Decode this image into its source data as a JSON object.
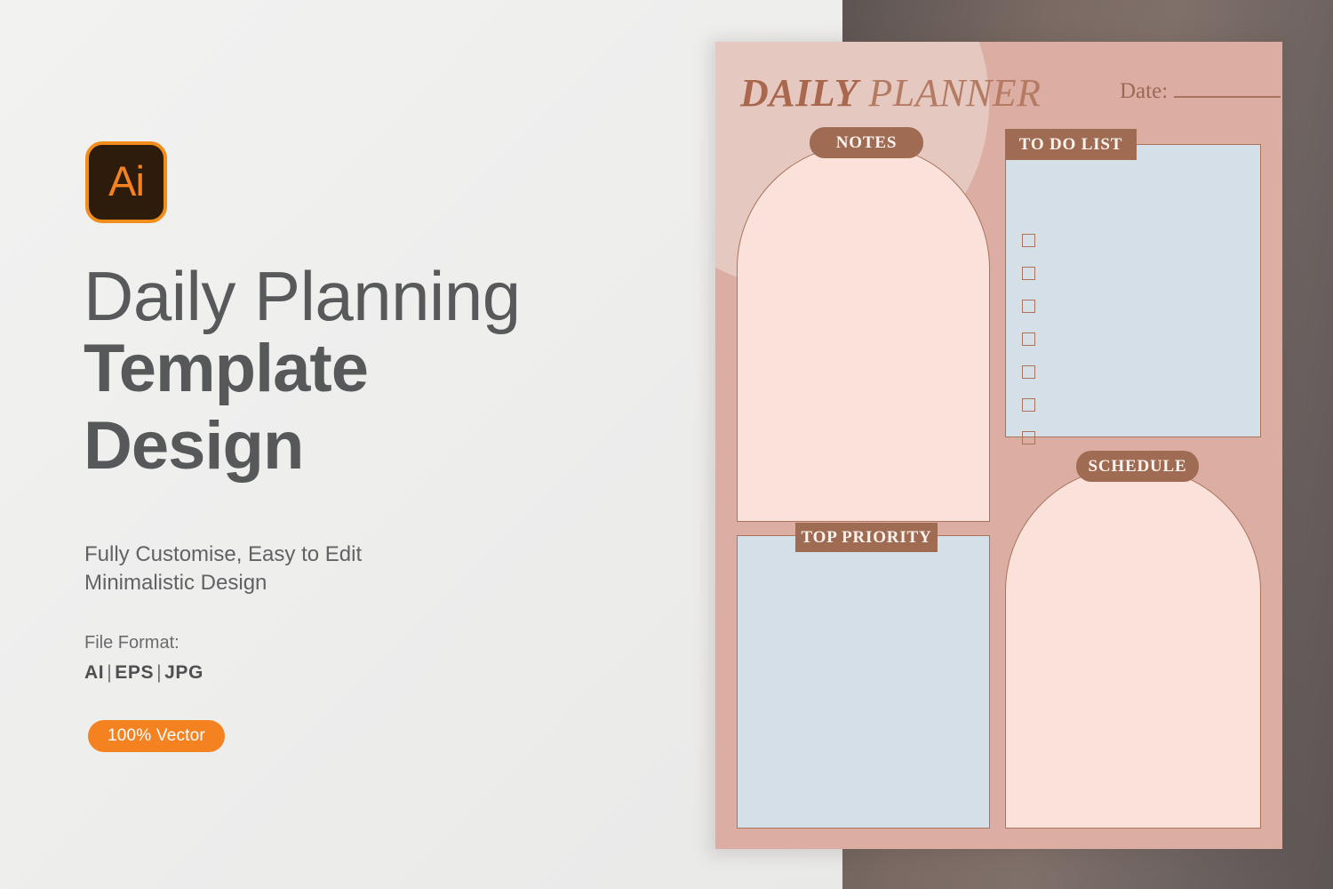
{
  "left_panel": {
    "logo": {
      "icon": "adobe-illustrator-icon",
      "text": "Ai",
      "bg_color": "#2d1c0b",
      "accent_color": "#f58220"
    },
    "headline": {
      "line1": "Daily Planning",
      "line2": "Template",
      "line3": "Design"
    },
    "subcopy": {
      "line1": "Fully Customise, Easy to Edit",
      "line2": "Minimalistic Design"
    },
    "file_format": {
      "label": "File Format:",
      "formats": [
        "AI",
        "EPS",
        "JPG"
      ],
      "separator": "|",
      "value": "AI  |  EPS  |  JPG"
    },
    "vector_badge": {
      "label": "100% Vector",
      "color": "#f58220"
    }
  },
  "planner": {
    "title_bold": "DAILY",
    "title_light": "PLANNER",
    "date_label": "Date:",
    "date_value": "",
    "colors": {
      "page_bg": "#dcaea3",
      "decor_circle": "#e5c8c0",
      "arch_fill": "#fae1da",
      "rect_fill": "#d5dfe8",
      "badge_bg": "#a06b53",
      "badge_text": "#fdf4ef",
      "outline": "#a9735c",
      "title_text": "#a9674e"
    },
    "sections": [
      {
        "key": "notes",
        "label": "NOTES",
        "shape": "arch",
        "badge_shape": "pill"
      },
      {
        "key": "todo",
        "label": "TO DO LIST",
        "shape": "rectangle",
        "badge_shape": "rectangle"
      },
      {
        "key": "priority",
        "label": "TOP PRIORITY",
        "shape": "rectangle",
        "badge_shape": "rectangle"
      },
      {
        "key": "schedule",
        "label": "SCHEDULE",
        "shape": "arch",
        "badge_shape": "pill"
      }
    ],
    "todo_checkbox_count": 7
  }
}
